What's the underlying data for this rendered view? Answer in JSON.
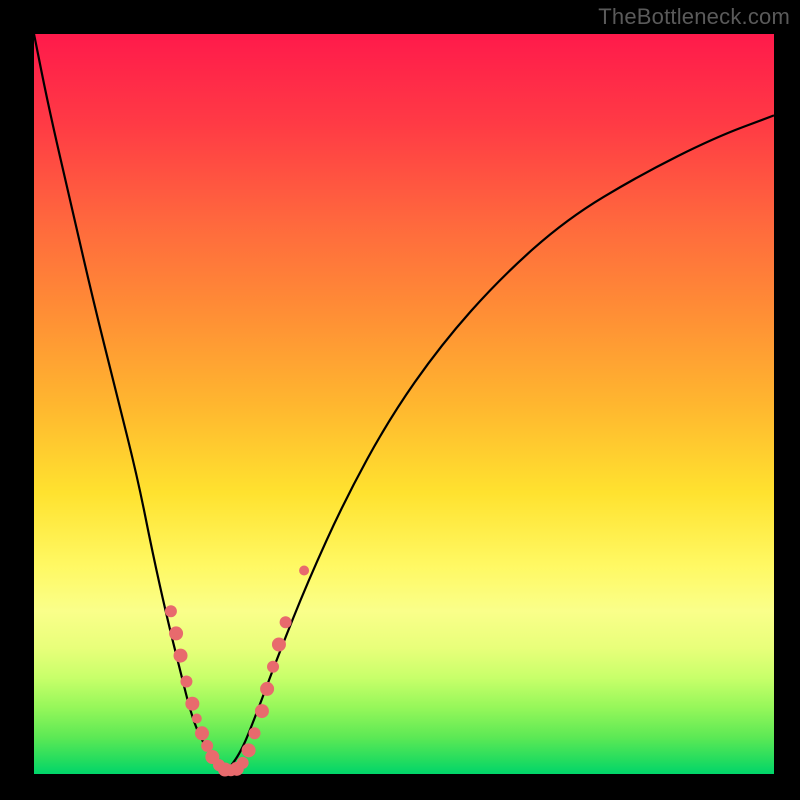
{
  "watermark": "TheBottleneck.com",
  "chart_data": {
    "type": "line",
    "title": "",
    "xlabel": "",
    "ylabel": "",
    "xlim": [
      0,
      100
    ],
    "ylim": [
      0,
      100
    ],
    "legend": false,
    "grid": false,
    "background_gradient": [
      "#ff1a4b",
      "#ff6a3d",
      "#ffb62f",
      "#fff964",
      "#5de955",
      "#00d56a"
    ],
    "series": [
      {
        "name": "left-branch",
        "x": [
          0,
          2,
          5,
          8,
          11,
          14,
          16,
          18,
          20,
          21,
          22,
          23,
          24,
          25,
          26
        ],
        "y": [
          100,
          90,
          77,
          64,
          52,
          40,
          30,
          21,
          13,
          9,
          6,
          4,
          2.5,
          1.2,
          0.3
        ]
      },
      {
        "name": "right-branch",
        "x": [
          26,
          28,
          30,
          33,
          37,
          42,
          48,
          55,
          63,
          72,
          82,
          92,
          100
        ],
        "y": [
          0.3,
          3,
          8,
          16,
          26,
          37,
          48,
          58,
          67,
          75,
          81,
          86,
          89
        ]
      }
    ],
    "scatter_points": {
      "name": "markers",
      "color": "#e86a6d",
      "points": [
        {
          "x": 18.5,
          "y": 22,
          "r": 6
        },
        {
          "x": 19.2,
          "y": 19,
          "r": 7
        },
        {
          "x": 19.8,
          "y": 16,
          "r": 7
        },
        {
          "x": 20.6,
          "y": 12.5,
          "r": 6
        },
        {
          "x": 21.4,
          "y": 9.5,
          "r": 7
        },
        {
          "x": 22.0,
          "y": 7.5,
          "r": 5
        },
        {
          "x": 22.7,
          "y": 5.5,
          "r": 7
        },
        {
          "x": 23.4,
          "y": 3.8,
          "r": 6
        },
        {
          "x": 24.1,
          "y": 2.3,
          "r": 7
        },
        {
          "x": 25.0,
          "y": 1.2,
          "r": 6
        },
        {
          "x": 25.8,
          "y": 0.6,
          "r": 7
        },
        {
          "x": 26.6,
          "y": 0.5,
          "r": 6
        },
        {
          "x": 27.4,
          "y": 0.7,
          "r": 7
        },
        {
          "x": 28.2,
          "y": 1.5,
          "r": 6
        },
        {
          "x": 29.0,
          "y": 3.2,
          "r": 7
        },
        {
          "x": 29.8,
          "y": 5.5,
          "r": 6
        },
        {
          "x": 30.8,
          "y": 8.5,
          "r": 7
        },
        {
          "x": 31.5,
          "y": 11.5,
          "r": 7
        },
        {
          "x": 32.3,
          "y": 14.5,
          "r": 6
        },
        {
          "x": 33.1,
          "y": 17.5,
          "r": 7
        },
        {
          "x": 34.0,
          "y": 20.5,
          "r": 6
        },
        {
          "x": 36.5,
          "y": 27.5,
          "r": 5
        }
      ]
    }
  }
}
